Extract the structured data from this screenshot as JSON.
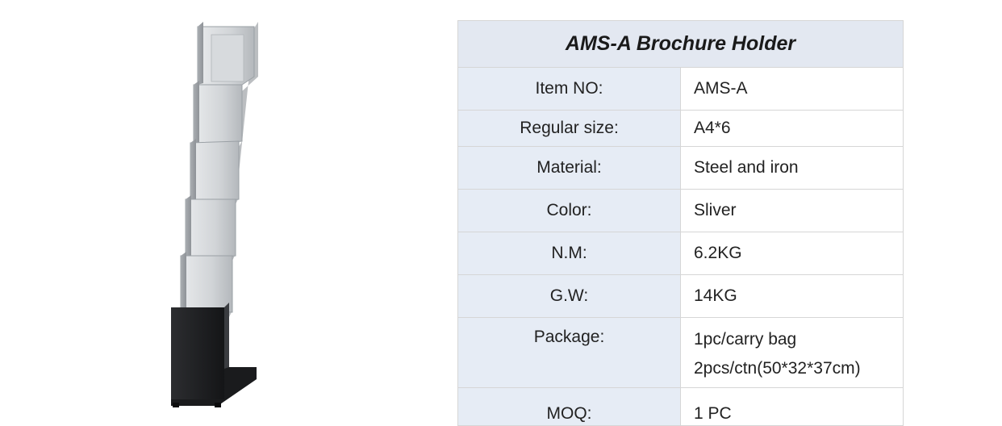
{
  "table": {
    "title": "AMS-A Brochure Holder",
    "rows": [
      {
        "label": "Item NO:",
        "value": "AMS-A"
      },
      {
        "label": "Regular size:",
        "value": "A4*6"
      },
      {
        "label": "Material:",
        "value": "Steel and iron"
      },
      {
        "label": "Color:",
        "value": "Sliver"
      },
      {
        "label": "N.M:",
        "value": "6.2KG"
      },
      {
        "label": "G.W:",
        "value": "14KG"
      },
      {
        "label": "Package:",
        "lines": [
          "1pc/carry bag",
          "2pcs/ctn(50*32*37cm)"
        ]
      },
      {
        "label": "MOQ:",
        "value": "1 PC"
      }
    ]
  },
  "colors": {
    "header_bg": "#e3e8f1",
    "label_bg": "#e6ecf5",
    "border": "#d6d6d6",
    "holder_silver": "#c9ccd0",
    "base_black": "#1e1f21"
  }
}
